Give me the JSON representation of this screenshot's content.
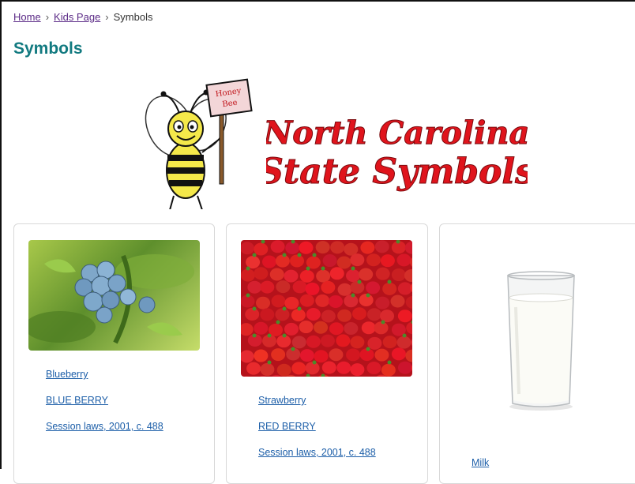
{
  "breadcrumb": {
    "home": "Home",
    "separator": "›",
    "kids": "Kids Page",
    "current": "Symbols"
  },
  "page": {
    "title": "Symbols"
  },
  "banner": {
    "sign_text_1": "Honey",
    "sign_text_2": "Bee",
    "line1": "North Carolina",
    "line2": "State Symbols"
  },
  "cards": [
    {
      "name": "Blueberry",
      "designation": "BLUE BERRY",
      "law": "Session laws, 2001, c. 488"
    },
    {
      "name": "Strawberry",
      "designation": "RED BERRY",
      "law": "Session laws, 2001, c. 488"
    },
    {
      "name": "Milk"
    }
  ],
  "colors": {
    "title": "#127a80",
    "link": "#1c5ea8",
    "breadcrumb_link": "#5b2a86",
    "banner_text": "#e0141c"
  }
}
